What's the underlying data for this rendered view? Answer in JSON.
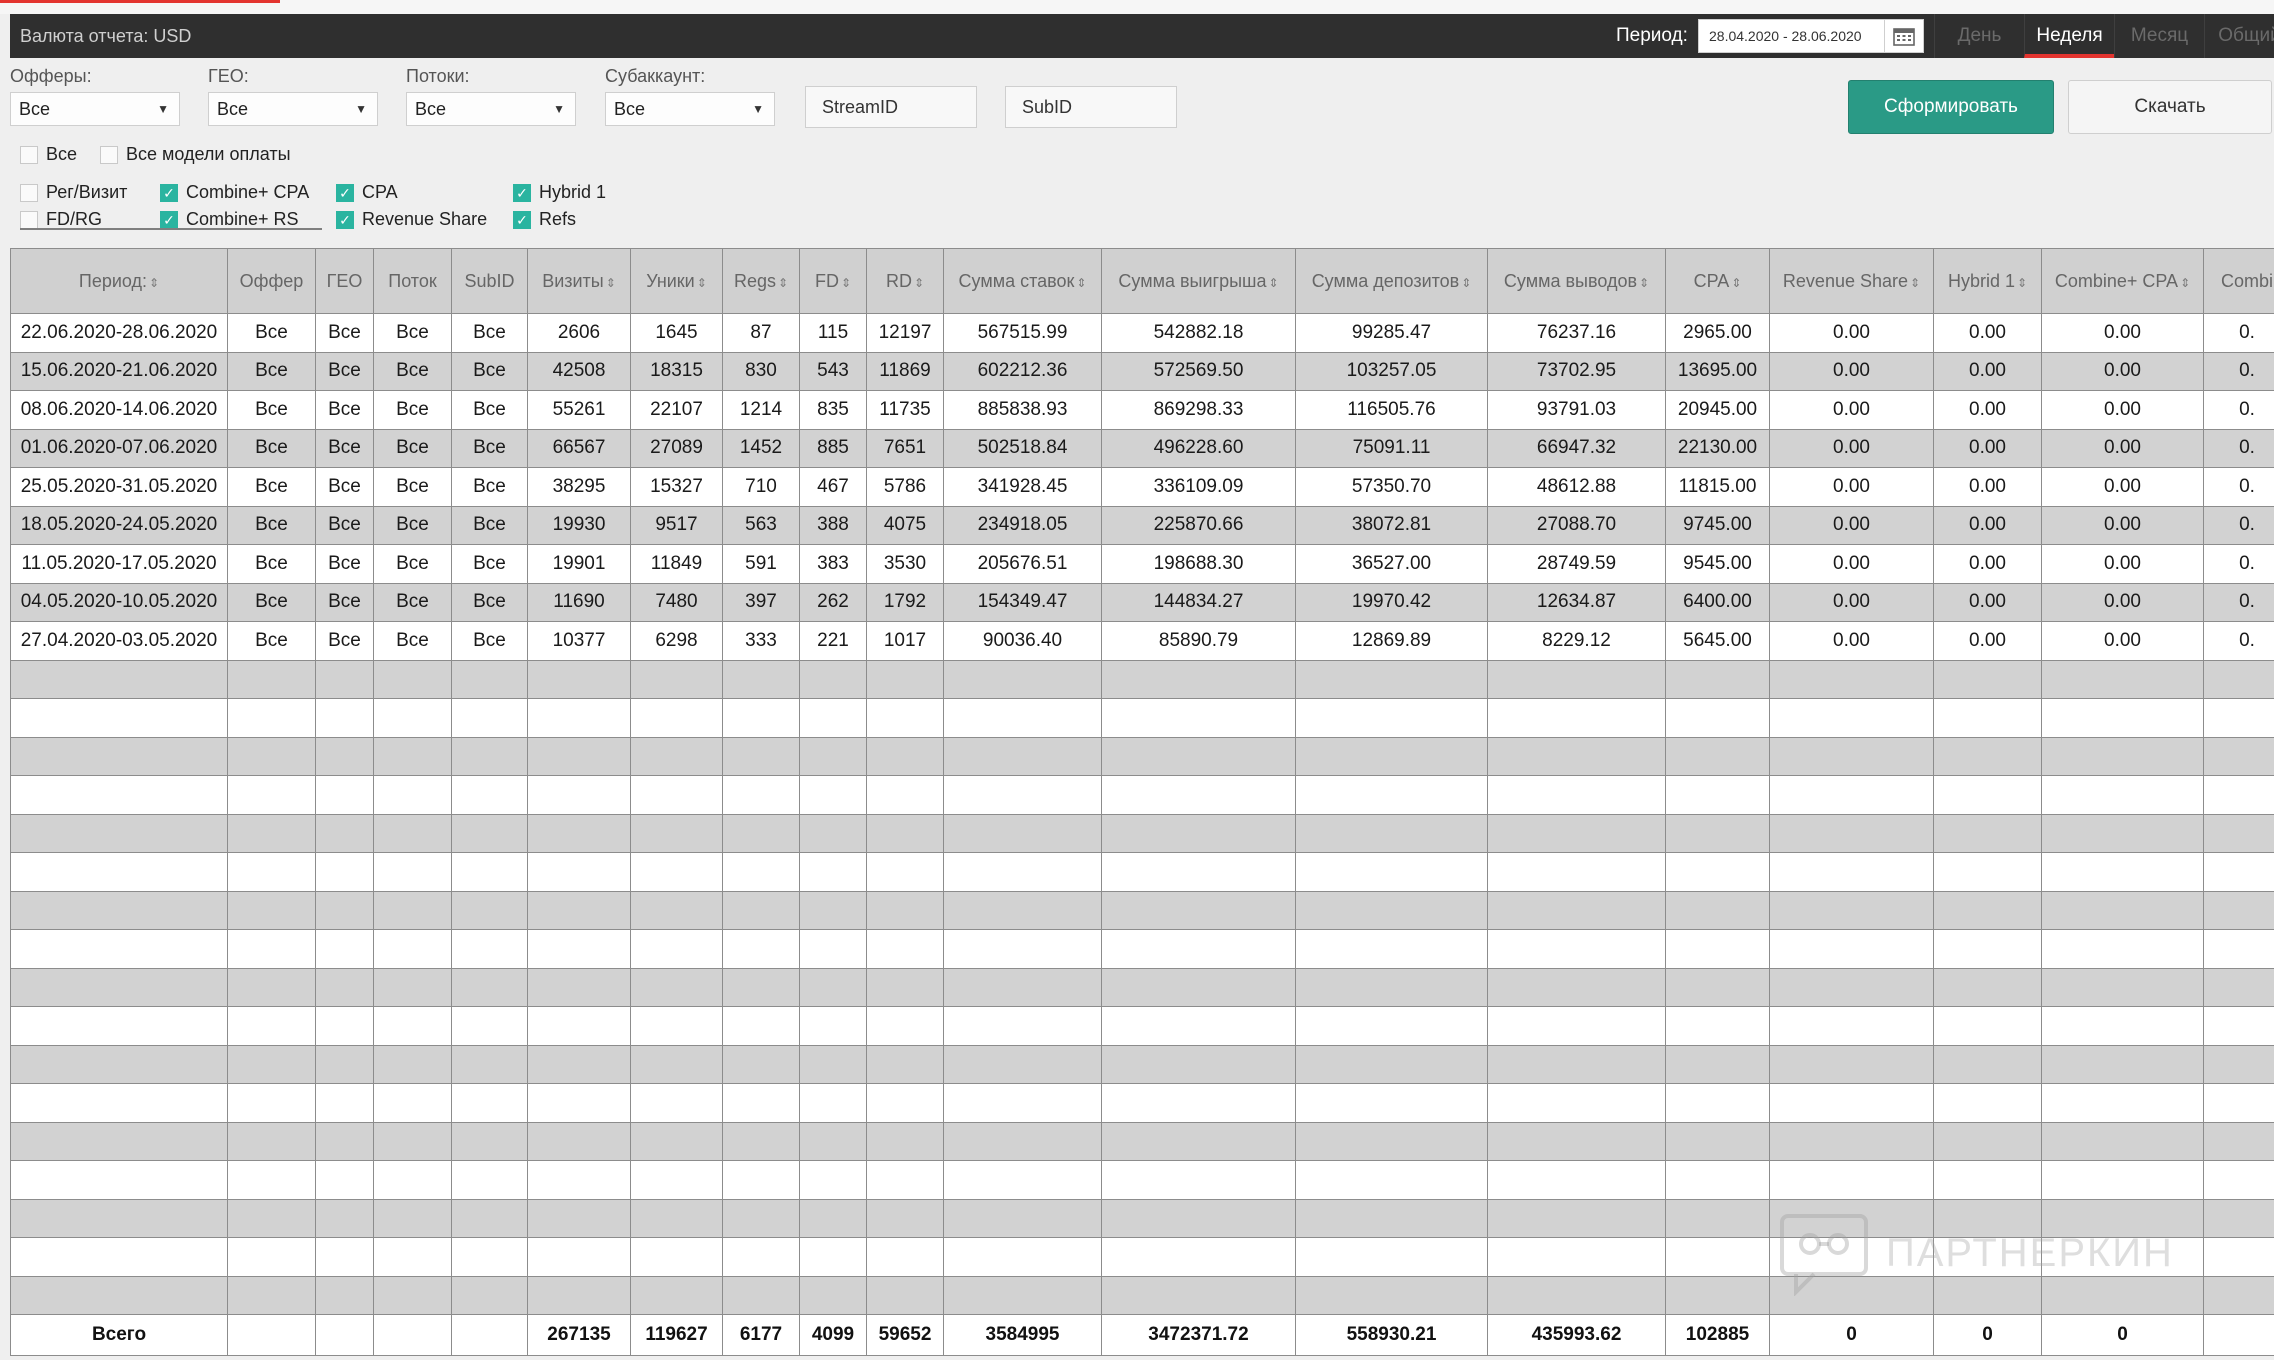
{
  "header": {
    "currency_label": "Валюта отчета: USD",
    "period_label": "Период:",
    "period_value": "28.04.2020 - 28.06.2020",
    "tabs": [
      {
        "label": "День",
        "active": false
      },
      {
        "label": "Неделя",
        "active": true
      },
      {
        "label": "Месяц",
        "active": false
      },
      {
        "label": "Общий",
        "active": false
      }
    ]
  },
  "filters": {
    "offers": {
      "label": "Офферы:",
      "value": "Все"
    },
    "geo": {
      "label": "ГЕО:",
      "value": "Все"
    },
    "streams": {
      "label": "Потоки:",
      "value": "Все"
    },
    "subaccount": {
      "label": "Субаккаунт:",
      "value": "Все"
    },
    "streamid_placeholder": "StreamID",
    "subid_placeholder": "SubID",
    "generate_button": "Сформировать",
    "download_button": "Скачать"
  },
  "payment_models": {
    "all": {
      "label": "Все",
      "checked": false
    },
    "all_models": {
      "label": "Все модели оплаты",
      "checked": false
    },
    "items": [
      {
        "label": "Рег/Визит",
        "checked": false
      },
      {
        "label": "FD/RG",
        "checked": false
      },
      {
        "label": "Combine+ CPA",
        "checked": true
      },
      {
        "label": "Combine+ RS",
        "checked": true
      },
      {
        "label": "CPA",
        "checked": true
      },
      {
        "label": "Revenue Share",
        "checked": true
      },
      {
        "label": "Hybrid 1",
        "checked": true
      },
      {
        "label": "Refs",
        "checked": true
      }
    ]
  },
  "table": {
    "columns": [
      {
        "label": "Период:",
        "sortable": true
      },
      {
        "label": "Оффер",
        "sortable": false
      },
      {
        "label": "ГЕО",
        "sortable": false
      },
      {
        "label": "Поток",
        "sortable": false
      },
      {
        "label": "SubID",
        "sortable": false
      },
      {
        "label": "Визиты",
        "sortable": true
      },
      {
        "label": "Уники",
        "sortable": true
      },
      {
        "label": "Regs",
        "sortable": true
      },
      {
        "label": "FD",
        "sortable": true
      },
      {
        "label": "RD",
        "sortable": true
      },
      {
        "label": "Сумма ставок",
        "sortable": true
      },
      {
        "label": "Сумма выигрыша",
        "sortable": true
      },
      {
        "label": "Сумма депозитов",
        "sortable": true
      },
      {
        "label": "Сумма выводов",
        "sortable": true
      },
      {
        "label": "CPA",
        "sortable": true
      },
      {
        "label": "Revenue Share",
        "sortable": true
      },
      {
        "label": "Hybrid 1",
        "sortable": true
      },
      {
        "label": "Combine+ CPA",
        "sortable": true
      },
      {
        "label": "Combi",
        "sortable": false
      }
    ],
    "rows": [
      [
        "22.06.2020-28.06.2020",
        "Все",
        "Все",
        "Все",
        "Все",
        "2606",
        "1645",
        "87",
        "115",
        "12197",
        "567515.99",
        "542882.18",
        "99285.47",
        "76237.16",
        "2965.00",
        "0.00",
        "0.00",
        "0.00",
        "0."
      ],
      [
        "15.06.2020-21.06.2020",
        "Все",
        "Все",
        "Все",
        "Все",
        "42508",
        "18315",
        "830",
        "543",
        "11869",
        "602212.36",
        "572569.50",
        "103257.05",
        "73702.95",
        "13695.00",
        "0.00",
        "0.00",
        "0.00",
        "0."
      ],
      [
        "08.06.2020-14.06.2020",
        "Все",
        "Все",
        "Все",
        "Все",
        "55261",
        "22107",
        "1214",
        "835",
        "11735",
        "885838.93",
        "869298.33",
        "116505.76",
        "93791.03",
        "20945.00",
        "0.00",
        "0.00",
        "0.00",
        "0."
      ],
      [
        "01.06.2020-07.06.2020",
        "Все",
        "Все",
        "Все",
        "Все",
        "66567",
        "27089",
        "1452",
        "885",
        "7651",
        "502518.84",
        "496228.60",
        "75091.11",
        "66947.32",
        "22130.00",
        "0.00",
        "0.00",
        "0.00",
        "0."
      ],
      [
        "25.05.2020-31.05.2020",
        "Все",
        "Все",
        "Все",
        "Все",
        "38295",
        "15327",
        "710",
        "467",
        "5786",
        "341928.45",
        "336109.09",
        "57350.70",
        "48612.88",
        "11815.00",
        "0.00",
        "0.00",
        "0.00",
        "0."
      ],
      [
        "18.05.2020-24.05.2020",
        "Все",
        "Все",
        "Все",
        "Все",
        "19930",
        "9517",
        "563",
        "388",
        "4075",
        "234918.05",
        "225870.66",
        "38072.81",
        "27088.70",
        "9745.00",
        "0.00",
        "0.00",
        "0.00",
        "0."
      ],
      [
        "11.05.2020-17.05.2020",
        "Все",
        "Все",
        "Все",
        "Все",
        "19901",
        "11849",
        "591",
        "383",
        "3530",
        "205676.51",
        "198688.30",
        "36527.00",
        "28749.59",
        "9545.00",
        "0.00",
        "0.00",
        "0.00",
        "0."
      ],
      [
        "04.05.2020-10.05.2020",
        "Все",
        "Все",
        "Все",
        "Все",
        "11690",
        "7480",
        "397",
        "262",
        "1792",
        "154349.47",
        "144834.27",
        "19970.42",
        "12634.87",
        "6400.00",
        "0.00",
        "0.00",
        "0.00",
        "0."
      ],
      [
        "27.04.2020-03.05.2020",
        "Все",
        "Все",
        "Все",
        "Все",
        "10377",
        "6298",
        "333",
        "221",
        "1017",
        "90036.40",
        "85890.79",
        "12869.89",
        "8229.12",
        "5645.00",
        "0.00",
        "0.00",
        "0.00",
        "0."
      ]
    ],
    "empty_rows": 17,
    "totals": [
      "Всего",
      "",
      "",
      "",
      "",
      "267135",
      "119627",
      "6177",
      "4099",
      "59652",
      "3584995",
      "3472371.72",
      "558930.21",
      "435993.62",
      "102885",
      "0",
      "0",
      "0",
      ""
    ]
  },
  "watermark": {
    "text": "ПАРТНЕРКИН"
  },
  "colors": {
    "accent": "#2a9a86",
    "tab_active_underline": "#e3342f",
    "header_bg": "#2f2f2f",
    "checkbox_on": "#2ab4a0"
  }
}
